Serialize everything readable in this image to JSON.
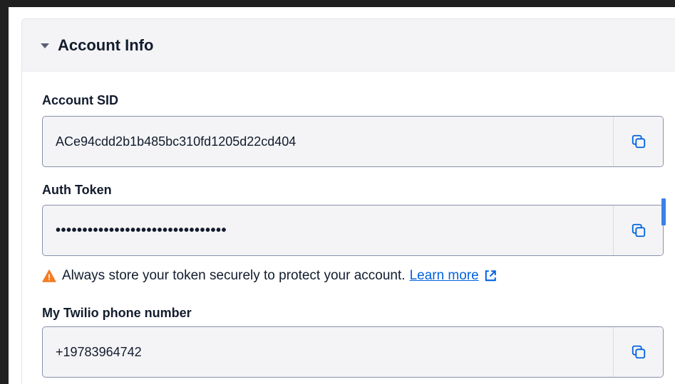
{
  "section": {
    "title": "Account Info"
  },
  "account_sid": {
    "label": "Account SID",
    "value": "ACe94cdd2b1b485bc310fd1205d22cd404"
  },
  "auth_token": {
    "label": "Auth Token",
    "value": "••••••••••••••••••••••••••••••••"
  },
  "warning": {
    "text": "Always store your token securely to protect your account.",
    "link_label": "Learn more"
  },
  "phone": {
    "label": "My Twilio phone number",
    "value": "+19783964742"
  },
  "colors": {
    "accent": "#0263e0",
    "warning": "#f47c22",
    "field_bg": "#f4f4f6",
    "field_border": "#8891aa"
  },
  "icons": [
    "chevron-down-icon",
    "copy-icon",
    "warning-icon",
    "external-link-icon"
  ]
}
